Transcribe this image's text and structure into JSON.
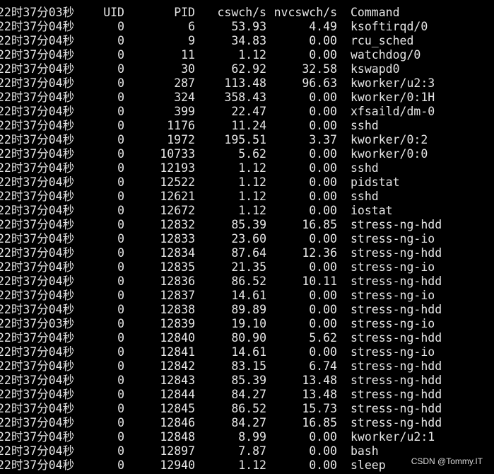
{
  "header": {
    "time": "22时37分03秒",
    "uid": "UID",
    "pid": "PID",
    "cswch": "cswch/s",
    "nvcswch": "nvcswch/s",
    "command": "Command"
  },
  "rows": [
    {
      "time": "22时37分04秒",
      "uid": "0",
      "pid": "6",
      "cswch": "53.93",
      "nvcswch": "4.49",
      "command": "ksoftirqd/0"
    },
    {
      "time": "22时37分04秒",
      "uid": "0",
      "pid": "9",
      "cswch": "34.83",
      "nvcswch": "0.00",
      "command": "rcu_sched"
    },
    {
      "time": "22时37分04秒",
      "uid": "0",
      "pid": "11",
      "cswch": "1.12",
      "nvcswch": "0.00",
      "command": "watchdog/0"
    },
    {
      "time": "22时37分04秒",
      "uid": "0",
      "pid": "30",
      "cswch": "62.92",
      "nvcswch": "32.58",
      "command": "kswapd0"
    },
    {
      "time": "22时37分04秒",
      "uid": "0",
      "pid": "287",
      "cswch": "113.48",
      "nvcswch": "96.63",
      "command": "kworker/u2:3"
    },
    {
      "time": "22时37分04秒",
      "uid": "0",
      "pid": "324",
      "cswch": "358.43",
      "nvcswch": "0.00",
      "command": "kworker/0:1H"
    },
    {
      "time": "22时37分04秒",
      "uid": "0",
      "pid": "399",
      "cswch": "22.47",
      "nvcswch": "0.00",
      "command": "xfsaild/dm-0"
    },
    {
      "time": "22时37分04秒",
      "uid": "0",
      "pid": "1176",
      "cswch": "11.24",
      "nvcswch": "0.00",
      "command": "sshd"
    },
    {
      "time": "22时37分04秒",
      "uid": "0",
      "pid": "1972",
      "cswch": "195.51",
      "nvcswch": "3.37",
      "command": "kworker/0:2"
    },
    {
      "time": "22时37分04秒",
      "uid": "0",
      "pid": "10733",
      "cswch": "5.62",
      "nvcswch": "0.00",
      "command": "kworker/0:0"
    },
    {
      "time": "22时37分04秒",
      "uid": "0",
      "pid": "12193",
      "cswch": "1.12",
      "nvcswch": "0.00",
      "command": "sshd"
    },
    {
      "time": "22时37分04秒",
      "uid": "0",
      "pid": "12522",
      "cswch": "1.12",
      "nvcswch": "0.00",
      "command": "pidstat"
    },
    {
      "time": "22时37分04秒",
      "uid": "0",
      "pid": "12621",
      "cswch": "1.12",
      "nvcswch": "0.00",
      "command": "sshd"
    },
    {
      "time": "22时37分04秒",
      "uid": "0",
      "pid": "12672",
      "cswch": "1.12",
      "nvcswch": "0.00",
      "command": "iostat"
    },
    {
      "time": "22时37分04秒",
      "uid": "0",
      "pid": "12832",
      "cswch": "85.39",
      "nvcswch": "16.85",
      "command": "stress-ng-hdd"
    },
    {
      "time": "22时37分04秒",
      "uid": "0",
      "pid": "12833",
      "cswch": "23.60",
      "nvcswch": "0.00",
      "command": "stress-ng-io"
    },
    {
      "time": "22时37分04秒",
      "uid": "0",
      "pid": "12834",
      "cswch": "87.64",
      "nvcswch": "12.36",
      "command": "stress-ng-hdd"
    },
    {
      "time": "22时37分04秒",
      "uid": "0",
      "pid": "12835",
      "cswch": "21.35",
      "nvcswch": "0.00",
      "command": "stress-ng-io"
    },
    {
      "time": "22时37分04秒",
      "uid": "0",
      "pid": "12836",
      "cswch": "86.52",
      "nvcswch": "10.11",
      "command": "stress-ng-hdd"
    },
    {
      "time": "22时37分04秒",
      "uid": "0",
      "pid": "12837",
      "cswch": "14.61",
      "nvcswch": "0.00",
      "command": "stress-ng-io"
    },
    {
      "time": "22时37分04秒",
      "uid": "0",
      "pid": "12838",
      "cswch": "89.89",
      "nvcswch": "0.00",
      "command": "stress-ng-hdd"
    },
    {
      "time": "22时37分03秒",
      "uid": "0",
      "pid": "12839",
      "cswch": "19.10",
      "nvcswch": "0.00",
      "command": "stress-ng-io"
    },
    {
      "time": "22时37分04秒",
      "uid": "0",
      "pid": "12840",
      "cswch": "80.90",
      "nvcswch": "5.62",
      "command": "stress-ng-hdd"
    },
    {
      "time": "22时37分04秒",
      "uid": "0",
      "pid": "12841",
      "cswch": "14.61",
      "nvcswch": "0.00",
      "command": "stress-ng-io"
    },
    {
      "time": "22时37分04秒",
      "uid": "0",
      "pid": "12842",
      "cswch": "83.15",
      "nvcswch": "6.74",
      "command": "stress-ng-hdd"
    },
    {
      "time": "22时37分04秒",
      "uid": "0",
      "pid": "12843",
      "cswch": "85.39",
      "nvcswch": "13.48",
      "command": "stress-ng-hdd"
    },
    {
      "time": "22时37分04秒",
      "uid": "0",
      "pid": "12844",
      "cswch": "84.27",
      "nvcswch": "13.48",
      "command": "stress-ng-hdd"
    },
    {
      "time": "22时37分04秒",
      "uid": "0",
      "pid": "12845",
      "cswch": "86.52",
      "nvcswch": "15.73",
      "command": "stress-ng-hdd"
    },
    {
      "time": "22时37分04秒",
      "uid": "0",
      "pid": "12846",
      "cswch": "84.27",
      "nvcswch": "16.85",
      "command": "stress-ng-hdd"
    },
    {
      "time": "22时37分04秒",
      "uid": "0",
      "pid": "12848",
      "cswch": "8.99",
      "nvcswch": "0.00",
      "command": "kworker/u2:1"
    },
    {
      "time": "22时37分04秒",
      "uid": "0",
      "pid": "12897",
      "cswch": "7.87",
      "nvcswch": "0.00",
      "command": "bash"
    },
    {
      "time": "22时37分04秒",
      "uid": "0",
      "pid": "12940",
      "cswch": "1.12",
      "nvcswch": "0.00",
      "command": "sleep"
    }
  ],
  "watermark": "CSDN @Tommy.IT",
  "colors": {
    "background": "#000000",
    "text": "#e6e6e6"
  }
}
